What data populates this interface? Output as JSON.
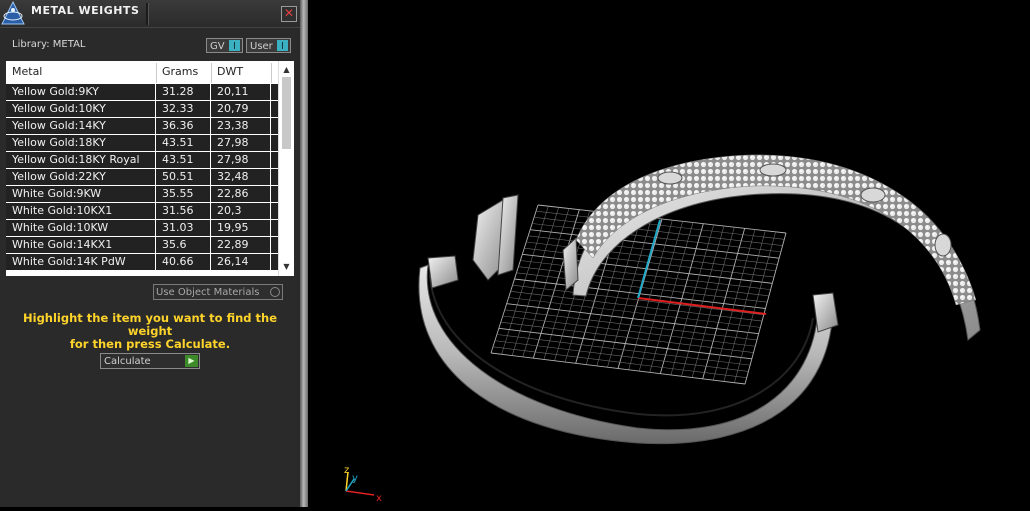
{
  "panel": {
    "title": "METAL WEIGHTS",
    "close_icon": "close-icon",
    "library_label": "Library: METAL",
    "toggles": [
      {
        "label": "GV",
        "icon": "toggle-switch-icon"
      },
      {
        "label": "User",
        "icon": "toggle-switch-icon"
      }
    ],
    "table": {
      "headers": [
        "Metal",
        "Grams",
        "DWT"
      ],
      "rows": [
        [
          "Yellow Gold:9KY",
          "31.28",
          "20,11"
        ],
        [
          "Yellow Gold:10KY",
          "32.33",
          "20,79"
        ],
        [
          "Yellow Gold:14KY",
          "36.36",
          "23,38"
        ],
        [
          "Yellow Gold:18KY",
          "43.51",
          "27,98"
        ],
        [
          "Yellow Gold:18KY Royal",
          "43.51",
          "27,98"
        ],
        [
          "Yellow Gold:22KY",
          "50.51",
          "32,48"
        ],
        [
          "White Gold:9KW",
          "35.55",
          "22,86"
        ],
        [
          "White Gold:10KX1",
          "31.56",
          "20,3"
        ],
        [
          "White Gold:10KW",
          "31.03",
          "19,95"
        ],
        [
          "White Gold:14KX1",
          "35.6",
          "22,89"
        ],
        [
          "White Gold:14K PdW",
          "40.66",
          "26,14"
        ]
      ],
      "scroll": {
        "position_fraction": 0.0
      }
    },
    "use_object_materials": "Use Object Materials",
    "instructions_line1": "Highlight the item you want to find the weight",
    "instructions_line2": "for then press Calculate.",
    "calculate": "Calculate"
  },
  "viewport": {
    "axis_labels": {
      "x": "x",
      "y": "y",
      "z": "z"
    },
    "colors": {
      "x_axis": "#e02020",
      "y_axis": "#1fa8c8",
      "grid": "#9a9a9a",
      "highlight": "#ffd42a"
    }
  }
}
